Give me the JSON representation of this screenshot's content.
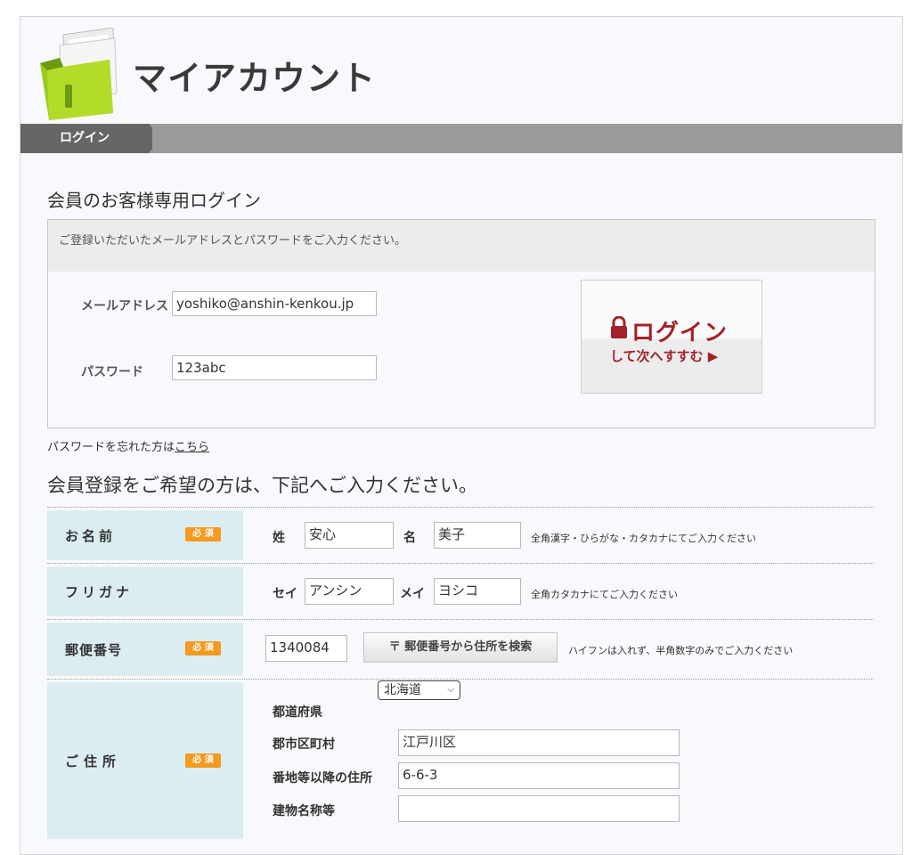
{
  "header": {
    "title": "マイアカウント"
  },
  "breadcrumb": {
    "current": "ログイン"
  },
  "login": {
    "heading": "会員のお客様専用ログイン",
    "hint": "ご登録いただいたメールアドレスとパスワードをご入力ください。",
    "email_label": "メールアドレス",
    "email_value": "yoshiko@anshin-kenkou.jp",
    "password_label": "パスワード",
    "password_value": "123abc",
    "button_main": "ログイン",
    "button_sub": "して次へすすむ ▶",
    "forgot_text": "パスワードを忘れた方は",
    "forgot_link": "こちら"
  },
  "registration": {
    "heading": "会員登録をご希望の方は、下記へご入力ください。",
    "required_badge": "必 須",
    "name": {
      "label": "お名前",
      "sei_label": "姓",
      "sei_value": "安心",
      "mei_label": "名",
      "mei_value": "美子",
      "note": "全角漢字・ひらがな・カタカナにてご入力ください"
    },
    "furigana": {
      "label": "フリガナ",
      "sei_label": "セイ",
      "sei_value": "アンシン",
      "mei_label": "メイ",
      "mei_value": "ヨシコ",
      "note": "全角カタカナにてご入力ください"
    },
    "postal": {
      "label": "郵便番号",
      "value": "1340084",
      "search_button": "〒 郵便番号から住所を検索",
      "note": "ハイフンは入れず、半角数字のみでご入力ください"
    },
    "address": {
      "label": "ご住所",
      "prefecture_label": "都道府県",
      "prefecture_value": "北海道",
      "city_label": "郡市区町村",
      "city_value": "江戸川区",
      "street_label": "番地等以降の住所",
      "street_value": "6-6-3",
      "building_label": "建物名称等",
      "building_value": ""
    }
  },
  "colors": {
    "accent_red": "#a3212a",
    "badge_orange": "#f39a1f",
    "row_label_bg": "#dcedf2",
    "nav_gray": "#9a9a9a"
  }
}
